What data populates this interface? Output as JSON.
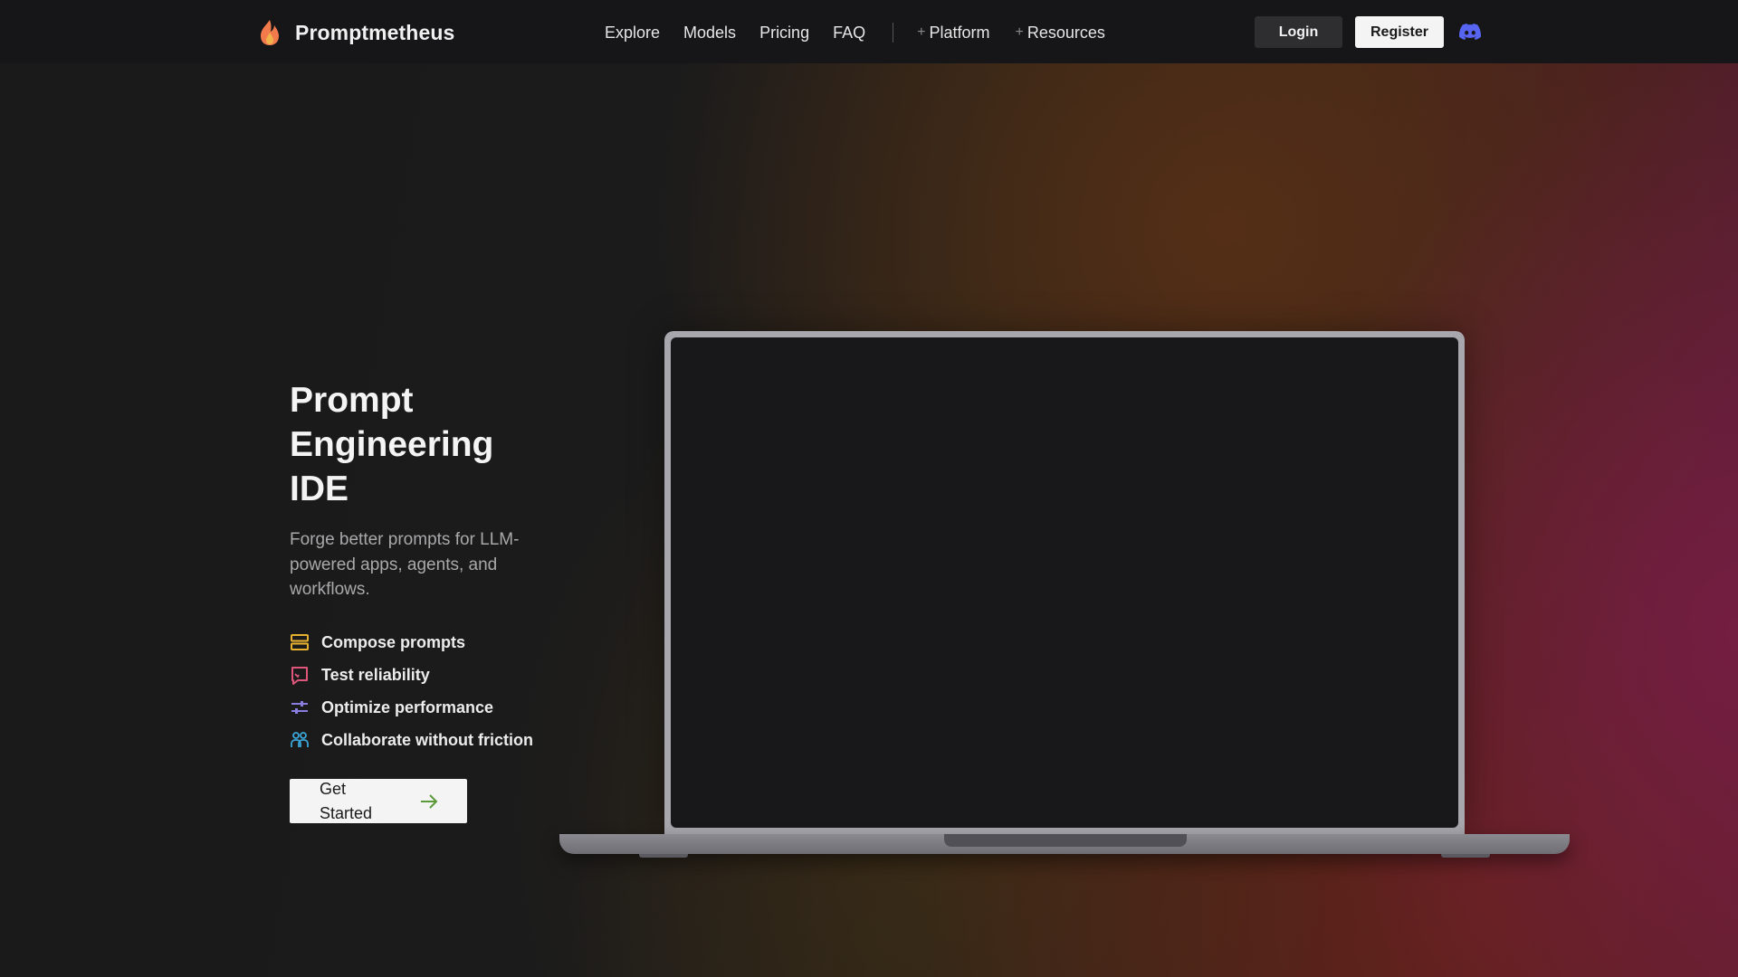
{
  "brand": {
    "name": "Promptmetheus",
    "logo_icon": "flame-icon",
    "colors": {
      "flame": "#f27a4b",
      "flame_inner": "#f2b24b"
    }
  },
  "nav": {
    "links": [
      "Explore",
      "Models",
      "Pricing",
      "FAQ"
    ],
    "groups": [
      "Platform",
      "Resources"
    ],
    "group_prefix": "+"
  },
  "auth": {
    "login_label": "Login",
    "register_label": "Register",
    "discord_icon": "discord-icon",
    "discord_color": "#5865F2"
  },
  "hero": {
    "title_lines": [
      "Prompt",
      "Engineering",
      "IDE"
    ],
    "subtitle": "Forge better prompts for LLM-powered apps, agents, and workflows.",
    "features": [
      {
        "label": "Compose prompts",
        "icon": "layers-icon",
        "color": "#e8b230"
      },
      {
        "label": "Test reliability",
        "icon": "chat-check-icon",
        "color": "#e0557a"
      },
      {
        "label": "Optimize performance",
        "icon": "sliders-icon",
        "color": "#8a7de0"
      },
      {
        "label": "Collaborate without friction",
        "icon": "users-icon",
        "color": "#3aa6d8"
      }
    ],
    "cta_label": "Get Started",
    "cta_icon": "arrow-right-icon",
    "cta_icon_color": "#5a9a3a"
  }
}
